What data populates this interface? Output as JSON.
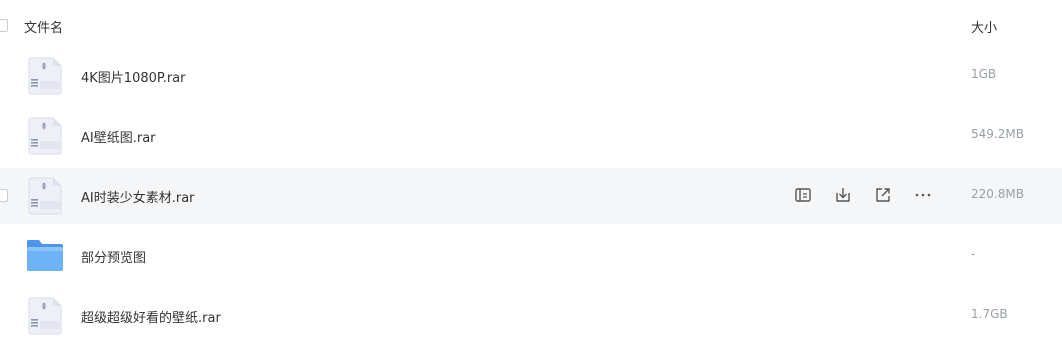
{
  "header": {
    "name_label": "文件名",
    "size_label": "大小"
  },
  "files": [
    {
      "name": "4K图片1080P.rar",
      "size": "1GB",
      "type": "archive",
      "icon": "archive-file-icon"
    },
    {
      "name": "AI壁纸图.rar",
      "size": "549.2MB",
      "type": "archive",
      "icon": "archive-file-icon"
    },
    {
      "name": "AI时装少女素材.rar",
      "size": "220.8MB",
      "type": "archive",
      "icon": "archive-file-icon",
      "hovered": true
    },
    {
      "name": "部分预览图",
      "size": "-",
      "type": "folder",
      "icon": "folder-icon"
    },
    {
      "name": "超级超级好看的壁纸.rar",
      "size": "1.7GB",
      "type": "archive",
      "icon": "archive-file-icon"
    }
  ],
  "row_actions": [
    "copy-icon",
    "download-icon",
    "share-icon",
    "more-icon"
  ],
  "colors": {
    "hover_row": "#f5f6f8",
    "size_text": "#9aa0a6",
    "folder_blue": "#5ea9f5",
    "archive_body": "#eef0f7"
  }
}
